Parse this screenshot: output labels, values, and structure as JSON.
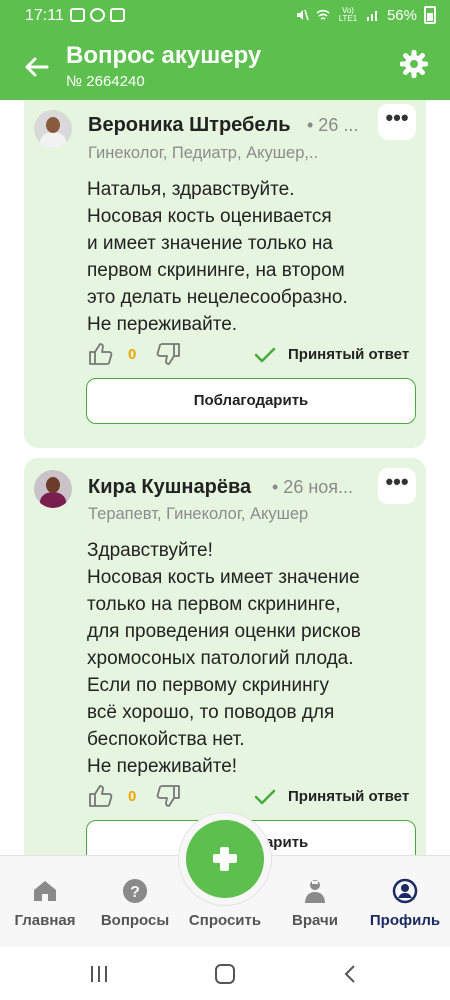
{
  "status_bar": {
    "time": "17:11",
    "lte_label": "Vo) LTE1",
    "battery": "56%"
  },
  "header": {
    "title": "Вопрос акушеру",
    "subtitle": "№ 2664240"
  },
  "answers": [
    {
      "author": "Вероника Штребель",
      "date": "• 26 ...",
      "specialties": "Гинеколог, Педиатр, Акушер,..",
      "text": "Наталья, здравствуйте.\nНосовая кость оценивается\nи имеет значение только на\nпервом скрининге, на втором\nэто делать нецелесообразно.\nНе переживайте.",
      "likes": "0",
      "status": "Принятый ответ",
      "thanks_label": "Поблагодарить"
    },
    {
      "author": "Кира Кушнарёва",
      "date": "• 26 ноя...",
      "specialties": "Терапевт, Гинеколог, Акушер",
      "text": "Здравствуйте!\nНосовая кость имеет значение\nтолько на первом скрининге,\nдля проведения оценки рисков\nхромосоных патологий плода.\nЕсли по первому скринингу\nвсё хорошо, то поводов для\nбеспокойства нет.\nНе переживайте!",
      "likes": "0",
      "status": "Принятый ответ",
      "thanks_label": "Поблагодарить"
    }
  ],
  "more_label": "•••",
  "bottom_nav": {
    "items": [
      {
        "label": "Главная",
        "icon": "home-icon"
      },
      {
        "label": "Вопросы",
        "icon": "question-icon"
      },
      {
        "label": "Спросить",
        "icon": "plus-icon"
      },
      {
        "label": "Врачи",
        "icon": "doctor-icon"
      },
      {
        "label": "Профиль",
        "icon": "profile-icon"
      }
    ],
    "active": "Профиль"
  },
  "colors": {
    "brand_green": "#5dbf4e",
    "card_background": "#e6f5df",
    "like_count": "#f0a500",
    "nav_active": "#1b2a60"
  }
}
